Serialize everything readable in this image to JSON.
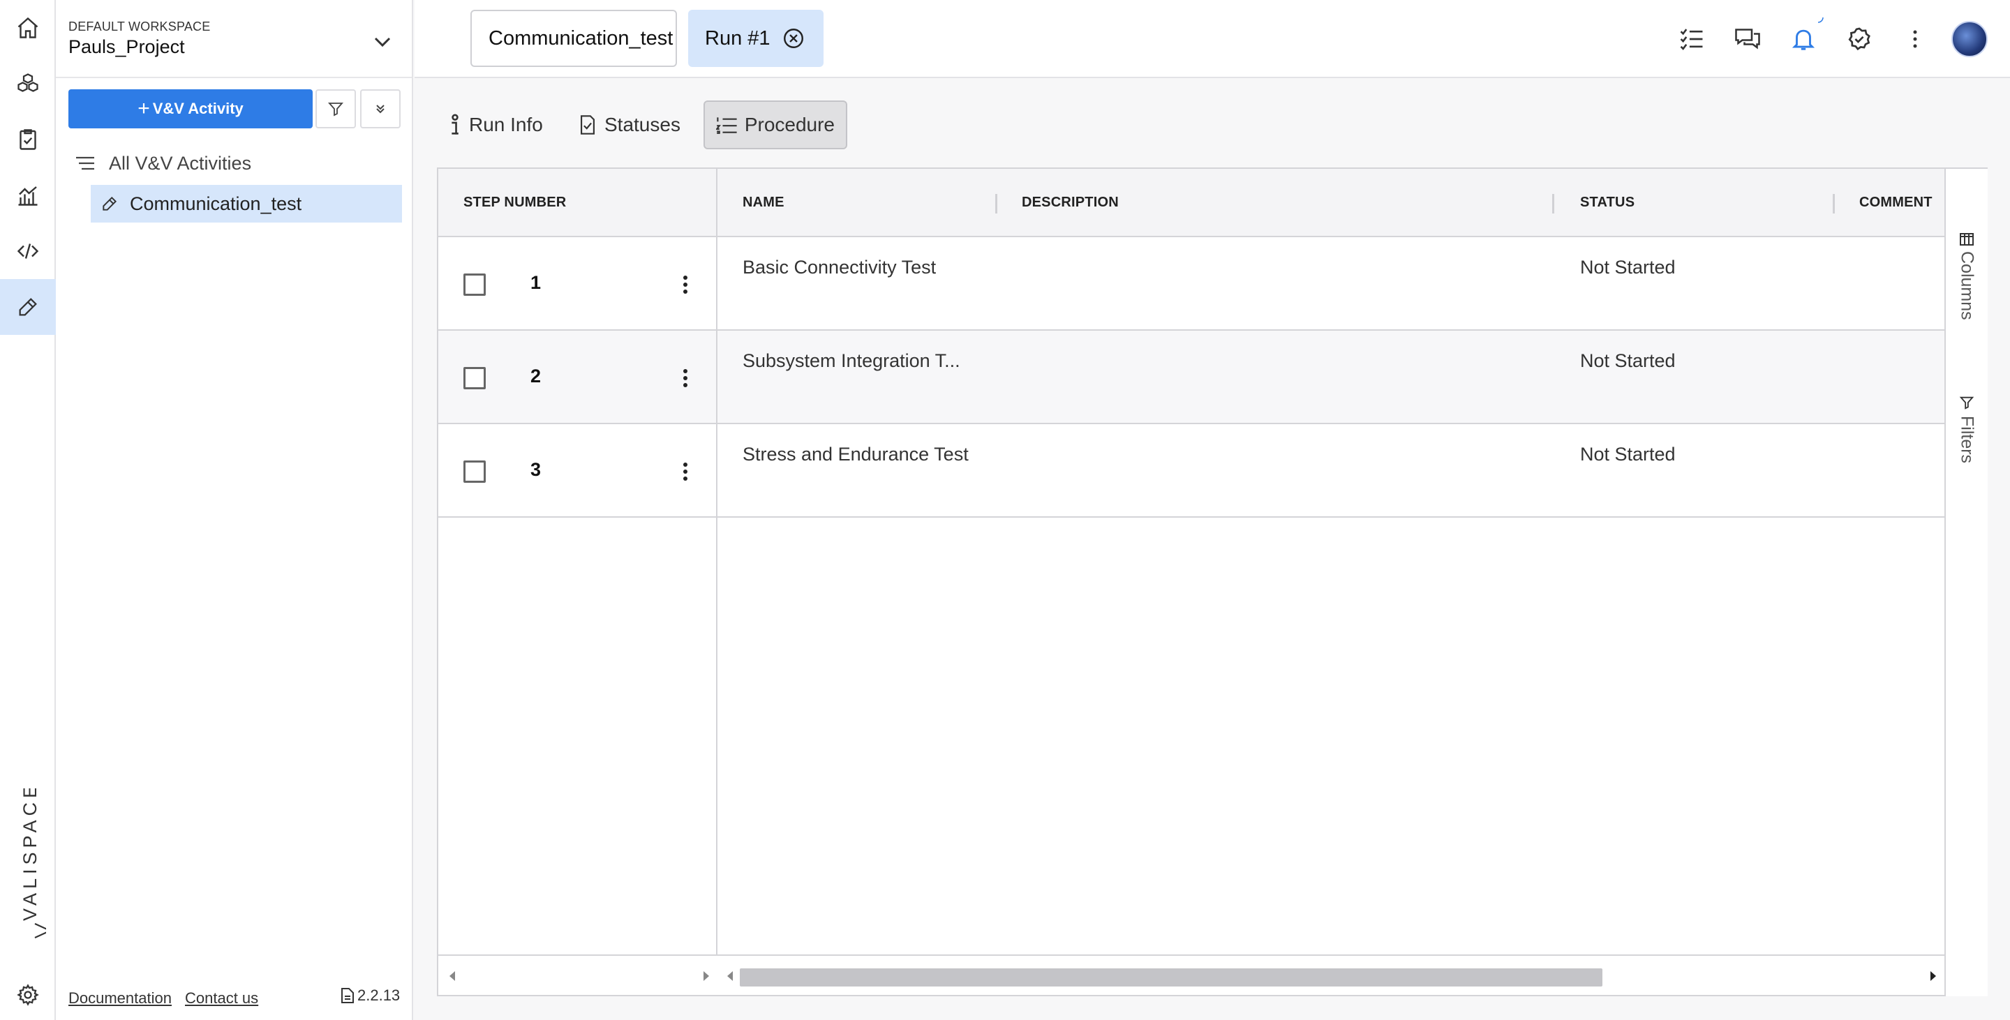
{
  "workspace": {
    "label": "DEFAULT WORKSPACE",
    "name": "Pauls_Project"
  },
  "sidebar": {
    "add_button": "V&V Activity",
    "all_activities": "All V&V Activities",
    "selected_activity": "Communication_test",
    "footer": {
      "documentation": "Documentation",
      "contact": "Contact us",
      "version": "2.2.13"
    }
  },
  "rail": {
    "brand": "VALISPACE",
    "icons": [
      "home-icon",
      "cubes-icon",
      "clipboard-check-icon",
      "analytics-icon",
      "code-icon",
      "ruler-pencil-icon",
      "gear-icon"
    ]
  },
  "topbar": {
    "tabs": [
      {
        "label": "Communication_test"
      },
      {
        "label": "Run #1"
      }
    ],
    "icons": [
      "checklist-icon",
      "chat-icon",
      "bell-icon",
      "verified-icon",
      "more-vertical-icon",
      "avatar"
    ]
  },
  "subtabs": [
    {
      "label": "Run Info",
      "icon": "info-icon"
    },
    {
      "label": "Statuses",
      "icon": "clipboard-check-icon"
    },
    {
      "label": "Procedure",
      "icon": "list-numbered-icon",
      "active": true
    }
  ],
  "table": {
    "columns": [
      "STEP NUMBER",
      "NAME",
      "DESCRIPTION",
      "STATUS",
      "COMMENT"
    ],
    "rows": [
      {
        "step": "1",
        "name": "Basic Connectivity Test",
        "description": "",
        "status": "Not Started",
        "comment": ""
      },
      {
        "step": "2",
        "name": "Subsystem Integration T...",
        "description": "",
        "status": "Not Started",
        "comment": ""
      },
      {
        "step": "3",
        "name": "Stress and Endurance Test",
        "description": "",
        "status": "Not Started",
        "comment": ""
      }
    ],
    "side_panel": [
      "Columns",
      "Filters"
    ]
  },
  "colors": {
    "accent": "#2e7ce6",
    "selected": "#d6e6fb",
    "bell": "#2e7ce6"
  }
}
